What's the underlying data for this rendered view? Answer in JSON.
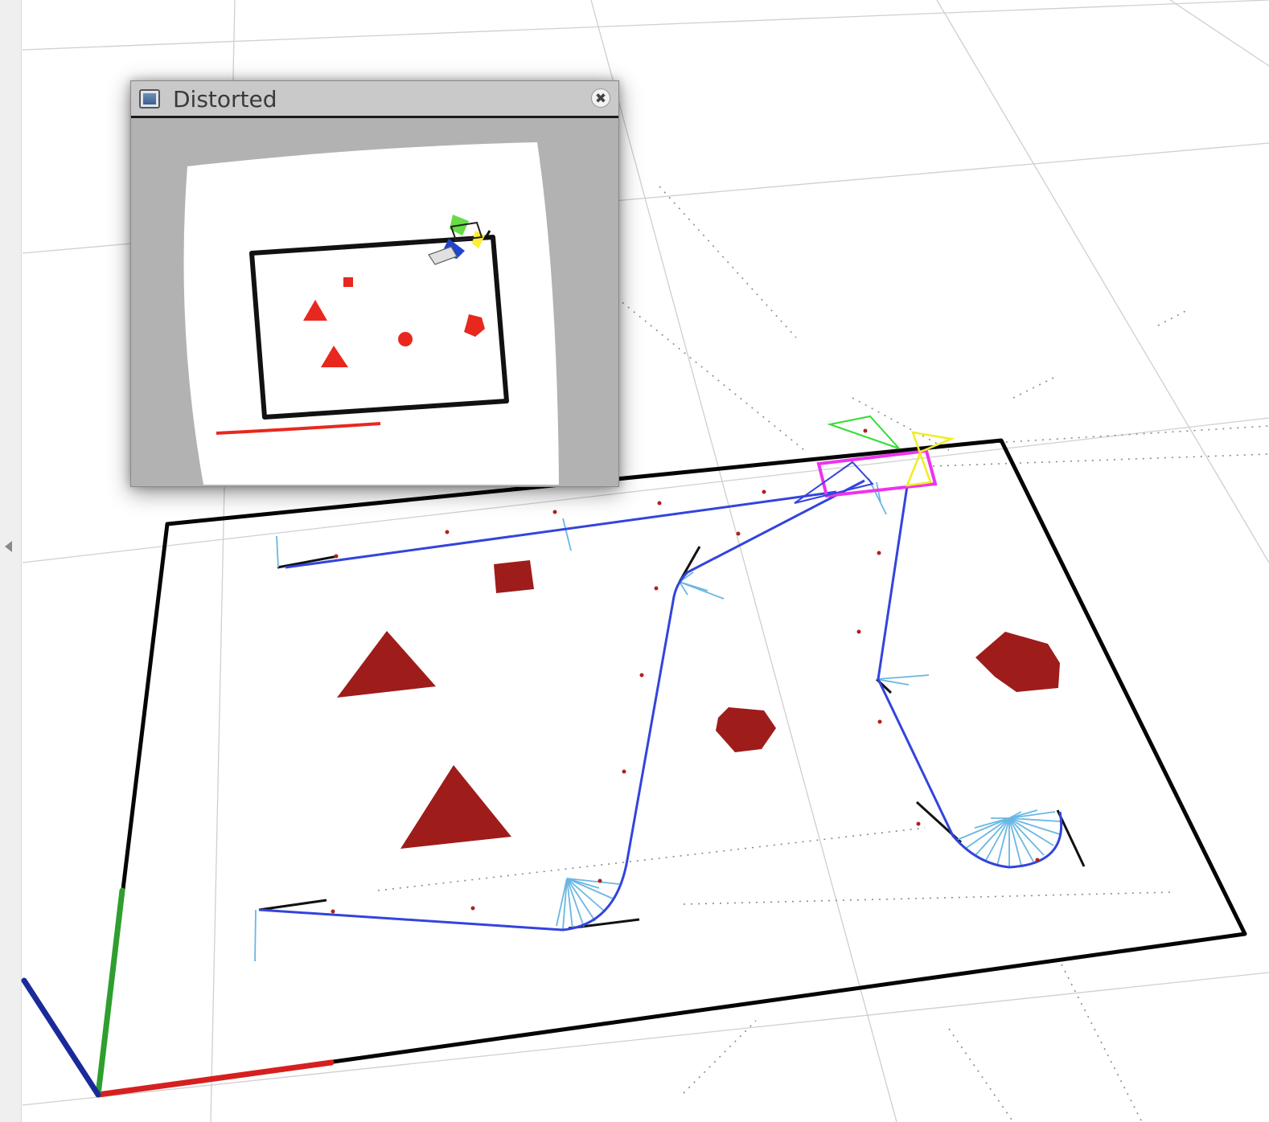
{
  "window": {
    "title": "Distorted",
    "close_glyph": "✖",
    "icon": "image-window-icon"
  },
  "sidebar": {
    "collapse_icon": "triangle-left-icon"
  },
  "colors": {
    "map_border": "#000000",
    "obstacle": "#9e1c1a",
    "path": "#3344dd",
    "laser": "#6bb7e3",
    "robot_frame": "#ee33ee",
    "camera_fov_green": "#33dd33",
    "camera_fov_yellow": "#eeee22",
    "axis_x": "#d62020",
    "axis_y": "#2f9e2f",
    "axis_z": "#1a2a9a",
    "grid": "#c8c8c8",
    "image_background": "#b2b2b2",
    "image_obstacle": "#e8281e"
  }
}
